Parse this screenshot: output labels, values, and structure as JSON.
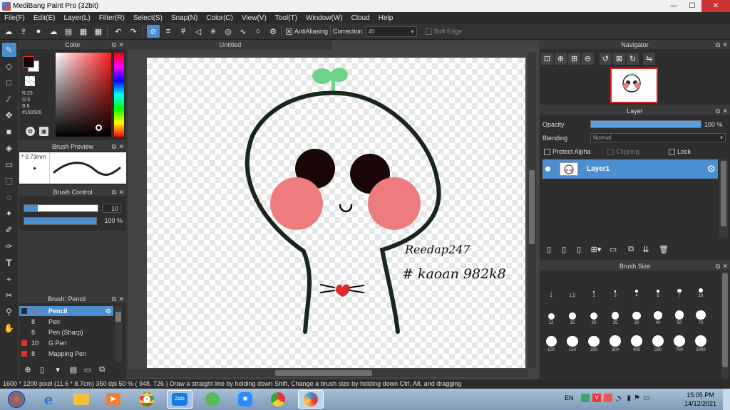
{
  "window": {
    "title": "MediBang Paint Pro (32bit)",
    "minimize": "—",
    "maximize": "☐",
    "close": "✕"
  },
  "menu": [
    "File(F)",
    "Edit(E)",
    "Layer(L)",
    "Filter(R)",
    "Select(S)",
    "Snap(N)",
    "Color(C)",
    "View(V)",
    "Tool(T)",
    "Window(W)",
    "Cloud",
    "Help"
  ],
  "toolbar": {
    "antialiasing_label": "AntiAliasing",
    "antialiasing_checked": "✕",
    "correction_label": "Correction",
    "correction_value": "40",
    "soft_edge_label": "Soft Edge"
  },
  "color_panel": {
    "title": "Color",
    "r": "R:25",
    "g": "G:5",
    "b": "B:6",
    "hex": "#190506",
    "fg": "#190506"
  },
  "brush_preview": {
    "title": "Brush Preview",
    "size": "0.73mm"
  },
  "brush_control": {
    "title": "Brush Control",
    "size_value": "10",
    "opacity_value": "100 %"
  },
  "brush_list": {
    "title": "Brush: Pencil",
    "items": [
      {
        "size": "10",
        "name": "Pencil",
        "color": "#3a3a3a"
      },
      {
        "size": "8",
        "name": "Pen",
        "color": "#3a3a3a"
      },
      {
        "size": "8",
        "name": "Pen (Sharp)",
        "color": "#3a3a3a"
      },
      {
        "size": "10",
        "name": "G Pen",
        "color": "#e03030"
      },
      {
        "size": "8",
        "name": "Mapping Pen",
        "color": "#e03030"
      }
    ]
  },
  "document": {
    "tab": "Untitled",
    "sign_line1": "Reedap247",
    "sign_line2": "# kaoan 982k8"
  },
  "navigator": {
    "title": "Navigator"
  },
  "layer_panel": {
    "title": "Layer",
    "opacity_label": "Opacity",
    "opacity_value": "100 %",
    "opacity_fraction": 1.0,
    "blending_label": "Blending",
    "blending_value": "Normal",
    "protect_alpha": "Protect Alpha",
    "clipping": "Clipping",
    "lock": "Lock",
    "layer_name": "Layer1"
  },
  "brush_size": {
    "title": "Brush Size",
    "sizes": [
      "1",
      "1.5",
      "2",
      "3",
      "4",
      "5",
      "7",
      "10",
      "12",
      "15",
      "20",
      "25",
      "30",
      "40",
      "50",
      "70",
      "100",
      "150",
      "200",
      "300",
      "400",
      "500",
      "700",
      "1000"
    ]
  },
  "status": {
    "text": "1600 * 1200 pixel   (11.6 * 8.7cm)   350 dpi   50 %   ( 948, 726 )   Draw a straight line by holding down Shift, Change a brush size by holding down Ctrl, Alt, and dragging"
  },
  "taskbar": {
    "lang": "EN",
    "time": "15:05 PM",
    "date": "14/12/2021",
    "zalo": "Zalo"
  }
}
